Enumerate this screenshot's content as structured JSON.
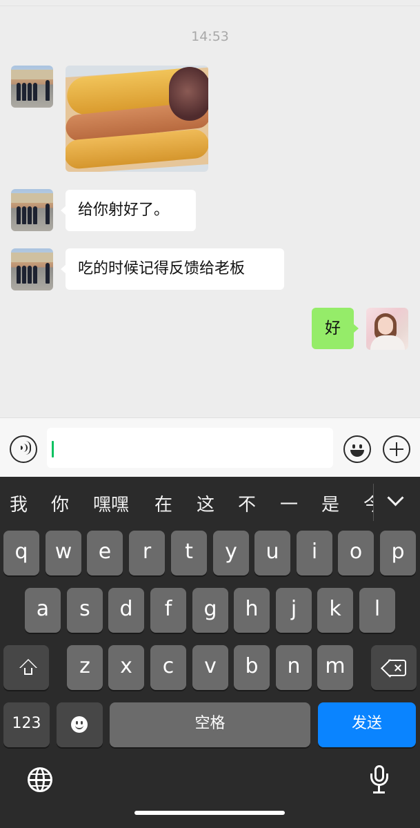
{
  "chat": {
    "timestamp": "14:53",
    "messages": [
      {
        "side": "left",
        "type": "image",
        "alt": "hot dog photo"
      },
      {
        "side": "left",
        "type": "text",
        "text": "给你射好了。"
      },
      {
        "side": "left",
        "type": "text",
        "text": "吃的时候记得反馈给老板"
      },
      {
        "side": "right",
        "type": "text",
        "text": "好"
      }
    ]
  },
  "input": {
    "value": "",
    "icons": [
      "voice-icon",
      "emoji-icon",
      "plus-icon"
    ]
  },
  "keyboard": {
    "candidates": [
      "我",
      "你",
      "嘿嘿",
      "在",
      "这",
      "不",
      "一",
      "是",
      "今"
    ],
    "row1": [
      "q",
      "w",
      "e",
      "r",
      "t",
      "y",
      "u",
      "i",
      "o",
      "p"
    ],
    "row2": [
      "a",
      "s",
      "d",
      "f",
      "g",
      "h",
      "j",
      "k",
      "l"
    ],
    "row3": [
      "z",
      "x",
      "c",
      "v",
      "b",
      "n",
      "m"
    ],
    "numbers_label": "123",
    "space_label": "空格",
    "send_label": "发送"
  },
  "colors": {
    "chat_bg": "#ededed",
    "sent_bubble": "#95ec69",
    "received_bubble": "#ffffff",
    "keyboard_bg": "#2b2b2b",
    "key": "#6b6b6b",
    "send_key": "#0a84ff",
    "caret": "#07c160"
  }
}
